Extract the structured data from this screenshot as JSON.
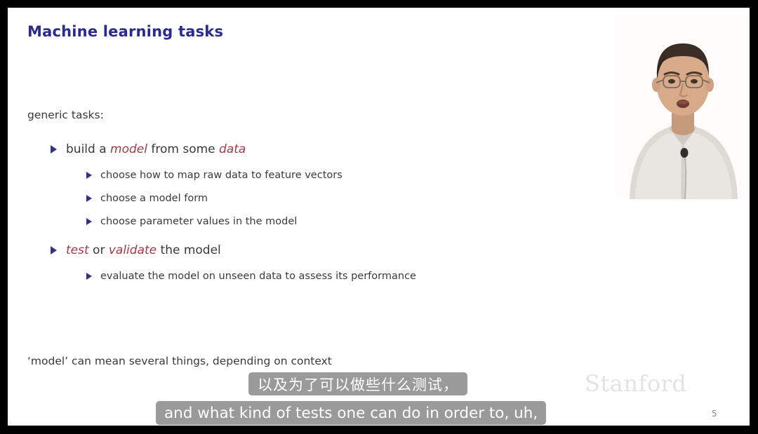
{
  "slide": {
    "title": "Machine learning tasks",
    "lead_generic": "generic tasks:",
    "lead_footer": "‘model’ can mean several things, depending on context",
    "page_number": "5",
    "wordmark": "Stanford",
    "bullets": {
      "build": {
        "pre": "build a ",
        "em1": "model",
        "mid": " from some ",
        "em2": "data"
      },
      "map": "choose how to map raw data to feature vectors",
      "form": "choose a model form",
      "param": "choose parameter values in the model",
      "test": {
        "em1": "test",
        "mid": " or ",
        "em2": "validate",
        "post": " the model"
      },
      "eval": "evaluate the model on unseen data to assess its performance"
    },
    "colors": {
      "title": "#2b2b8f",
      "bullet_marker": "#31318c",
      "emphasis": "#a23a46",
      "body_text": "#3a3a3a",
      "wordmark": "#e3e3e3",
      "slide_background": "#ffffff",
      "frame": "#000000"
    }
  },
  "subtitles": {
    "chinese": "以及为了可以做些什么测试，",
    "english": "and what kind of tests one can do in order to, uh,",
    "background": "#9a9a9a",
    "text_color": "#ffffff"
  },
  "speaker_video": {
    "label": "speaker-webcam-overlay",
    "description": "presenter with glasses and light collared shirt with lapel microphone"
  }
}
